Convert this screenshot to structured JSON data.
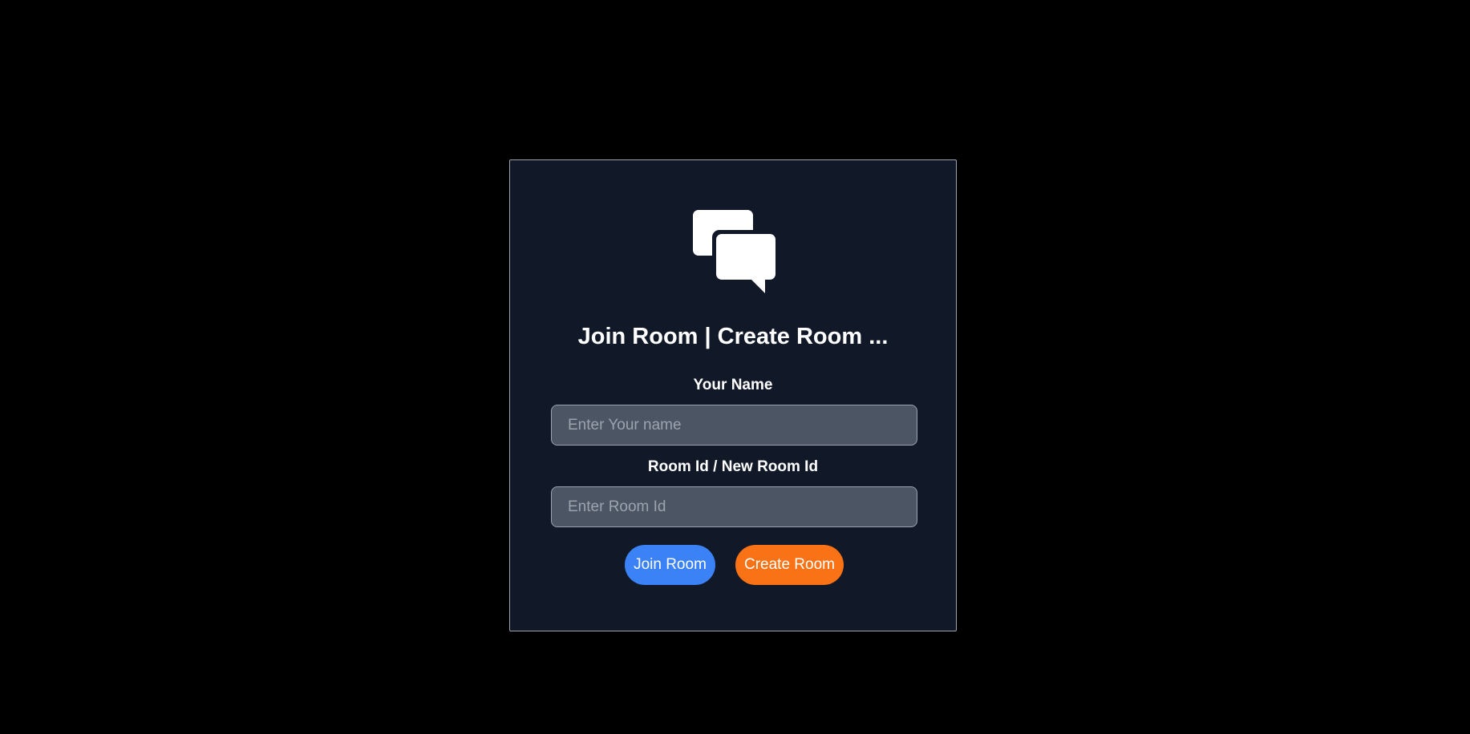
{
  "app": {
    "title": "Join Room | Create Room ..."
  },
  "form": {
    "name_label": "Your Name",
    "name_placeholder": "Enter Your name",
    "name_value": "",
    "room_label": "Room Id / New Room Id",
    "room_placeholder": "Enter Room Id",
    "room_value": ""
  },
  "buttons": {
    "join_label": "Join Room",
    "create_label": "Create Room"
  },
  "icons": {
    "logo": "chat-bubbles-icon"
  },
  "colors": {
    "page_background": "#000000",
    "card_background": "#111827",
    "input_background": "#4b5563",
    "join_button": "#3b82f6",
    "create_button": "#f97316"
  }
}
